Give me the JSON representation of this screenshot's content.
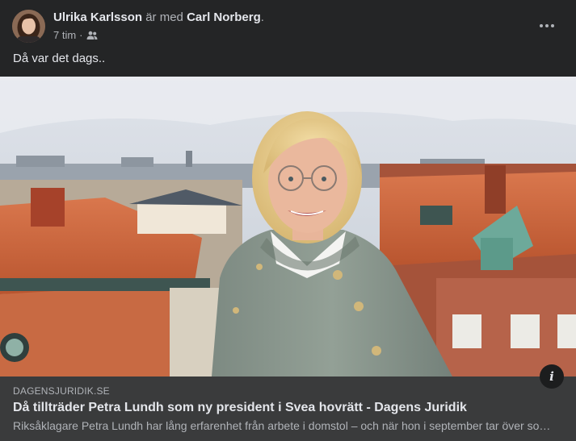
{
  "post": {
    "author": "Ulrika Karlsson",
    "with_text": "är med",
    "tagged": "Carl Norberg",
    "tail": ".",
    "time": "7 tim",
    "separator": "·",
    "audience_icon": "friends-icon",
    "more_icon": "more-options-icon",
    "message": "Då var det dags.."
  },
  "link": {
    "domain": "DAGENSJURIDIK.SE",
    "title": "Då tillträder Petra Lundh som ny president i Svea hovrätt - Dagens Juridik",
    "description": "Riksåklagare Petra Lundh har lång erfarenhet från arbete i domstol – och när hon i september tar över som president i Svea hovrätt",
    "info_icon": "info-icon",
    "info_glyph": "i"
  },
  "colors": {
    "background": "#242526",
    "link_panel": "#3a3b3c",
    "primary_text": "#e4e6eb",
    "secondary_text": "#b0b3b8"
  }
}
